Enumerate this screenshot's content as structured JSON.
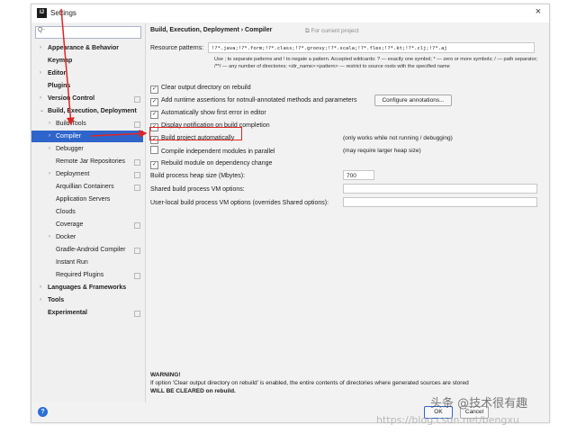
{
  "window": {
    "title": "Settings",
    "app_icon": "IJ",
    "close_glyph": "×"
  },
  "sidebar": {
    "search_placeholder": "Q-",
    "items": [
      {
        "label": "Appearance & Behavior"
      },
      {
        "label": "Keymap"
      },
      {
        "label": "Editor"
      },
      {
        "label": "Plugins"
      },
      {
        "label": "Version Control"
      },
      {
        "label": "Build, Execution, Deployment"
      },
      {
        "label": "Build Tools"
      },
      {
        "label": "Compiler"
      },
      {
        "label": "Debugger"
      },
      {
        "label": "Remote Jar Repositories"
      },
      {
        "label": "Deployment"
      },
      {
        "label": "Arquillian Containers"
      },
      {
        "label": "Application Servers"
      },
      {
        "label": "Clouds"
      },
      {
        "label": "Coverage"
      },
      {
        "label": "Docker"
      },
      {
        "label": "Gradle-Android Compiler"
      },
      {
        "label": "Instant Run"
      },
      {
        "label": "Required Plugins"
      },
      {
        "label": "Languages & Frameworks"
      },
      {
        "label": "Tools"
      },
      {
        "label": "Experimental"
      }
    ]
  },
  "content": {
    "breadcrumb": "Build, Execution, Deployment  ›  Compiler",
    "for_current_project": "⧉ For current project",
    "resource_patterns_label": "Resource patterns:",
    "resource_patterns_value": "!?*.java;!?*.form;!?*.class;!?*.groovy;!?*.scala;!?*.flex;!?*.kt;!?*.clj;!?*.aj",
    "resource_patterns_help": "Use ; to separate patterns and ! to negate a pattern. Accepted wildcards: ? — exactly one symbol; * — zero or more symbols; / — path separator; /**/ — any number of directories; <dir_name>:<pattern> — restrict to source roots with the specified name",
    "checkboxes": [
      {
        "label": "Clear output directory on rebuild",
        "checked": true
      },
      {
        "label": "Add runtime assertions for notnull-annotated methods and parameters",
        "checked": true
      },
      {
        "label": "Automatically show first error in editor",
        "checked": true
      },
      {
        "label": "Display notification on build completion",
        "checked": true
      },
      {
        "label": "Build project automatically",
        "checked": true
      },
      {
        "label": "Compile independent modules in parallel",
        "checked": false
      },
      {
        "label": "Rebuild module on dependency change",
        "checked": true
      }
    ],
    "configure_annotations_button": "Configure annotations...",
    "note_build_auto": "(only works while not running / debugging)",
    "note_parallel": "(may require larger heap size)",
    "heap_label": "Build process heap size (Mbytes):",
    "heap_value": "700",
    "shared_vm_label": "Shared build process VM options:",
    "shared_vm_value": "",
    "user_vm_label": "User-local build process VM options (overrides Shared options):",
    "user_vm_value": "",
    "warning_head": "WARNING!",
    "warning_line1": "If option 'Clear output directory on rebuild' is enabled, the entire contents of directories where generated sources are stored",
    "warning_line2": "WILL BE CLEARED on rebuild."
  },
  "footer": {
    "help": "?",
    "ok": "OK",
    "cancel": "Cancel"
  },
  "watermarks": {
    "top": "头条 @技术很有趣",
    "bottom": "https://blog.csdn.net/bengxu"
  },
  "colors": {
    "selection": "#2f65ca",
    "highlight_box": "#e02424",
    "arrow": "#e02424"
  }
}
